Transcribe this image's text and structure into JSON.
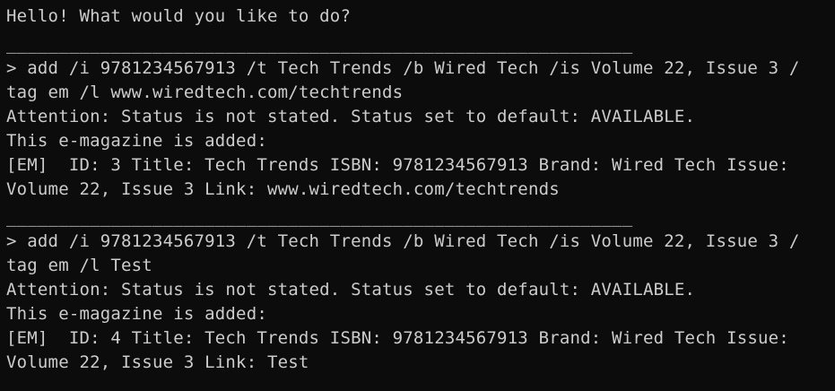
{
  "terminal": {
    "greeting": "Hello! What would you like to do?",
    "separator": "____________________________________________________________",
    "blocks": [
      {
        "command_line_1": "> add /i 9781234567913 /t Tech Trends /b Wired Tech /is Volume 22, Issue 3 /",
        "command_line_2": "tag em /l www.wiredtech.com/techtrends",
        "attention": "Attention: Status is not stated. Status set to default: AVAILABLE.",
        "added": "This e-magazine is added:",
        "result_line_1": "[EM]  ID: 3 Title: Tech Trends ISBN: 9781234567913 Brand: Wired Tech Issue:",
        "result_line_2": "Volume 22, Issue 3 Link: www.wiredtech.com/techtrends"
      },
      {
        "command_line_1": "> add /i 9781234567913 /t Tech Trends /b Wired Tech /is Volume 22, Issue 3 /",
        "command_line_2": "tag em /l Test",
        "attention": "Attention: Status is not stated. Status set to default: AVAILABLE.",
        "added": "This e-magazine is added:",
        "result_line_1": "[EM]  ID: 4 Title: Tech Trends ISBN: 9781234567913 Brand: Wired Tech Issue:",
        "result_line_2": "Volume 22, Issue 3 Link: Test"
      }
    ]
  }
}
